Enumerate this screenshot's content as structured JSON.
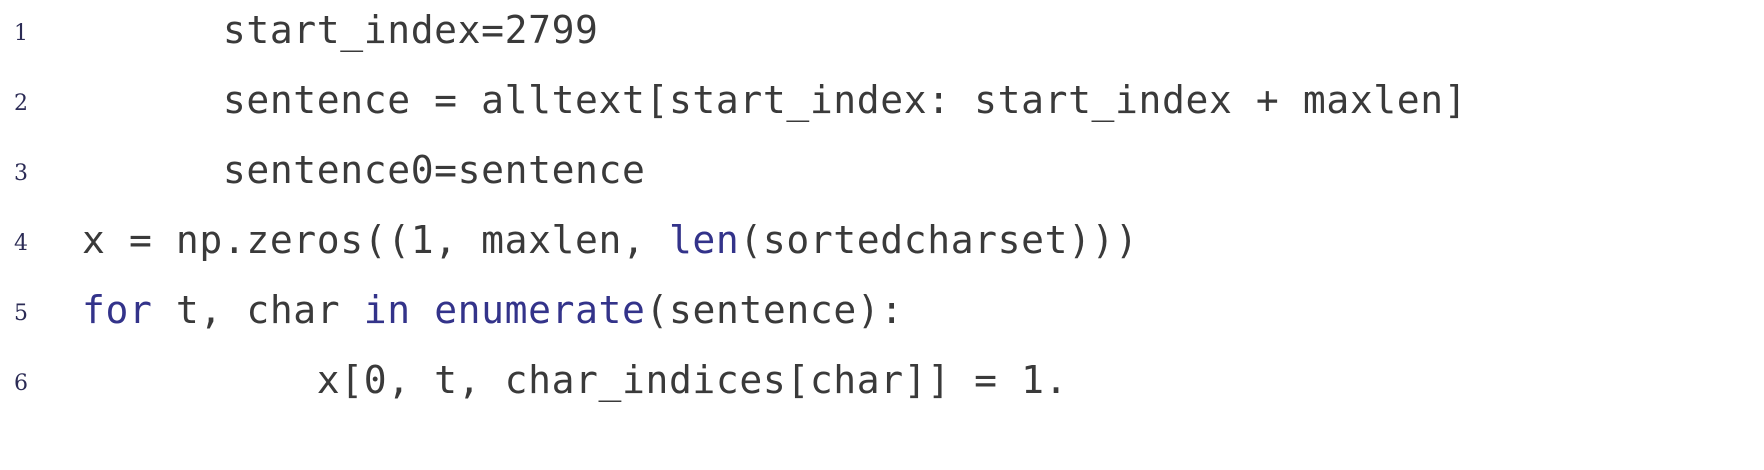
{
  "code": {
    "lines": [
      {
        "number": "1",
        "tokens": [
          {
            "text": "start_index=2799",
            "kind": "plain"
          }
        ]
      },
      {
        "number": "2",
        "tokens": [
          {
            "text": "sentence = alltext[start_index: start_index + maxlen]",
            "kind": "plain"
          }
        ]
      },
      {
        "number": "3",
        "tokens": [
          {
            "text": "sentence0=sentence",
            "kind": "plain"
          }
        ]
      },
      {
        "number": "4",
        "tokens": [
          {
            "text": "x = np.zeros((1, maxlen, ",
            "kind": "plain"
          },
          {
            "text": "len",
            "kind": "builtin"
          },
          {
            "text": "(sortedcharset)))",
            "kind": "plain"
          }
        ]
      },
      {
        "number": "5",
        "tokens": [
          {
            "text": "for",
            "kind": "kw"
          },
          {
            "text": " t, char ",
            "kind": "plain"
          },
          {
            "text": "in",
            "kind": "kw"
          },
          {
            "text": " ",
            "kind": "plain"
          },
          {
            "text": "enumerate",
            "kind": "builtin"
          },
          {
            "text": "(sentence):",
            "kind": "plain"
          }
        ]
      },
      {
        "number": "6",
        "tokens": [
          {
            "text": "    x[0, t, char_indices[char]] = 1.",
            "kind": "plain"
          }
        ]
      }
    ],
    "colors": {
      "keyword": "#33338a",
      "text": "#3a3a3a",
      "line_number": "#2b2b55",
      "background": "#ffffff"
    }
  }
}
